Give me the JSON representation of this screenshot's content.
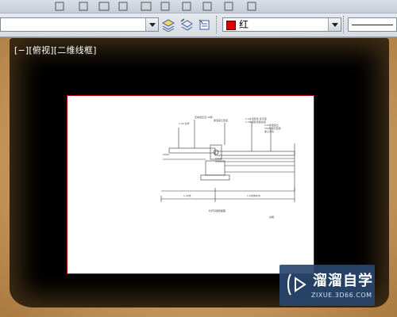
{
  "toolbar": {
    "layer_combo_value": "",
    "color_combo_value": "红",
    "color_swatch": "#e00000",
    "linetype_value": ""
  },
  "viewport": {
    "label": "[−][俯视][二维线框]",
    "background": "#000000"
  },
  "drawing": {
    "title": "栏杆基础剖面图",
    "annotations": [
      "1:20 栏杆",
      "花岗岩压顶 30厚",
      "素混凝土垫层",
      "1:2水泥砂浆 找平层",
      "1:3水泥砂浆结合层",
      "C15素混凝土",
      "150厚碎石垫层",
      "素土夯实",
      "1.20米",
      "1.2米排水沟",
      "说明"
    ]
  },
  "watermark": {
    "title": "溜溜自学",
    "url": "ZIXUE.3D66.COM"
  }
}
